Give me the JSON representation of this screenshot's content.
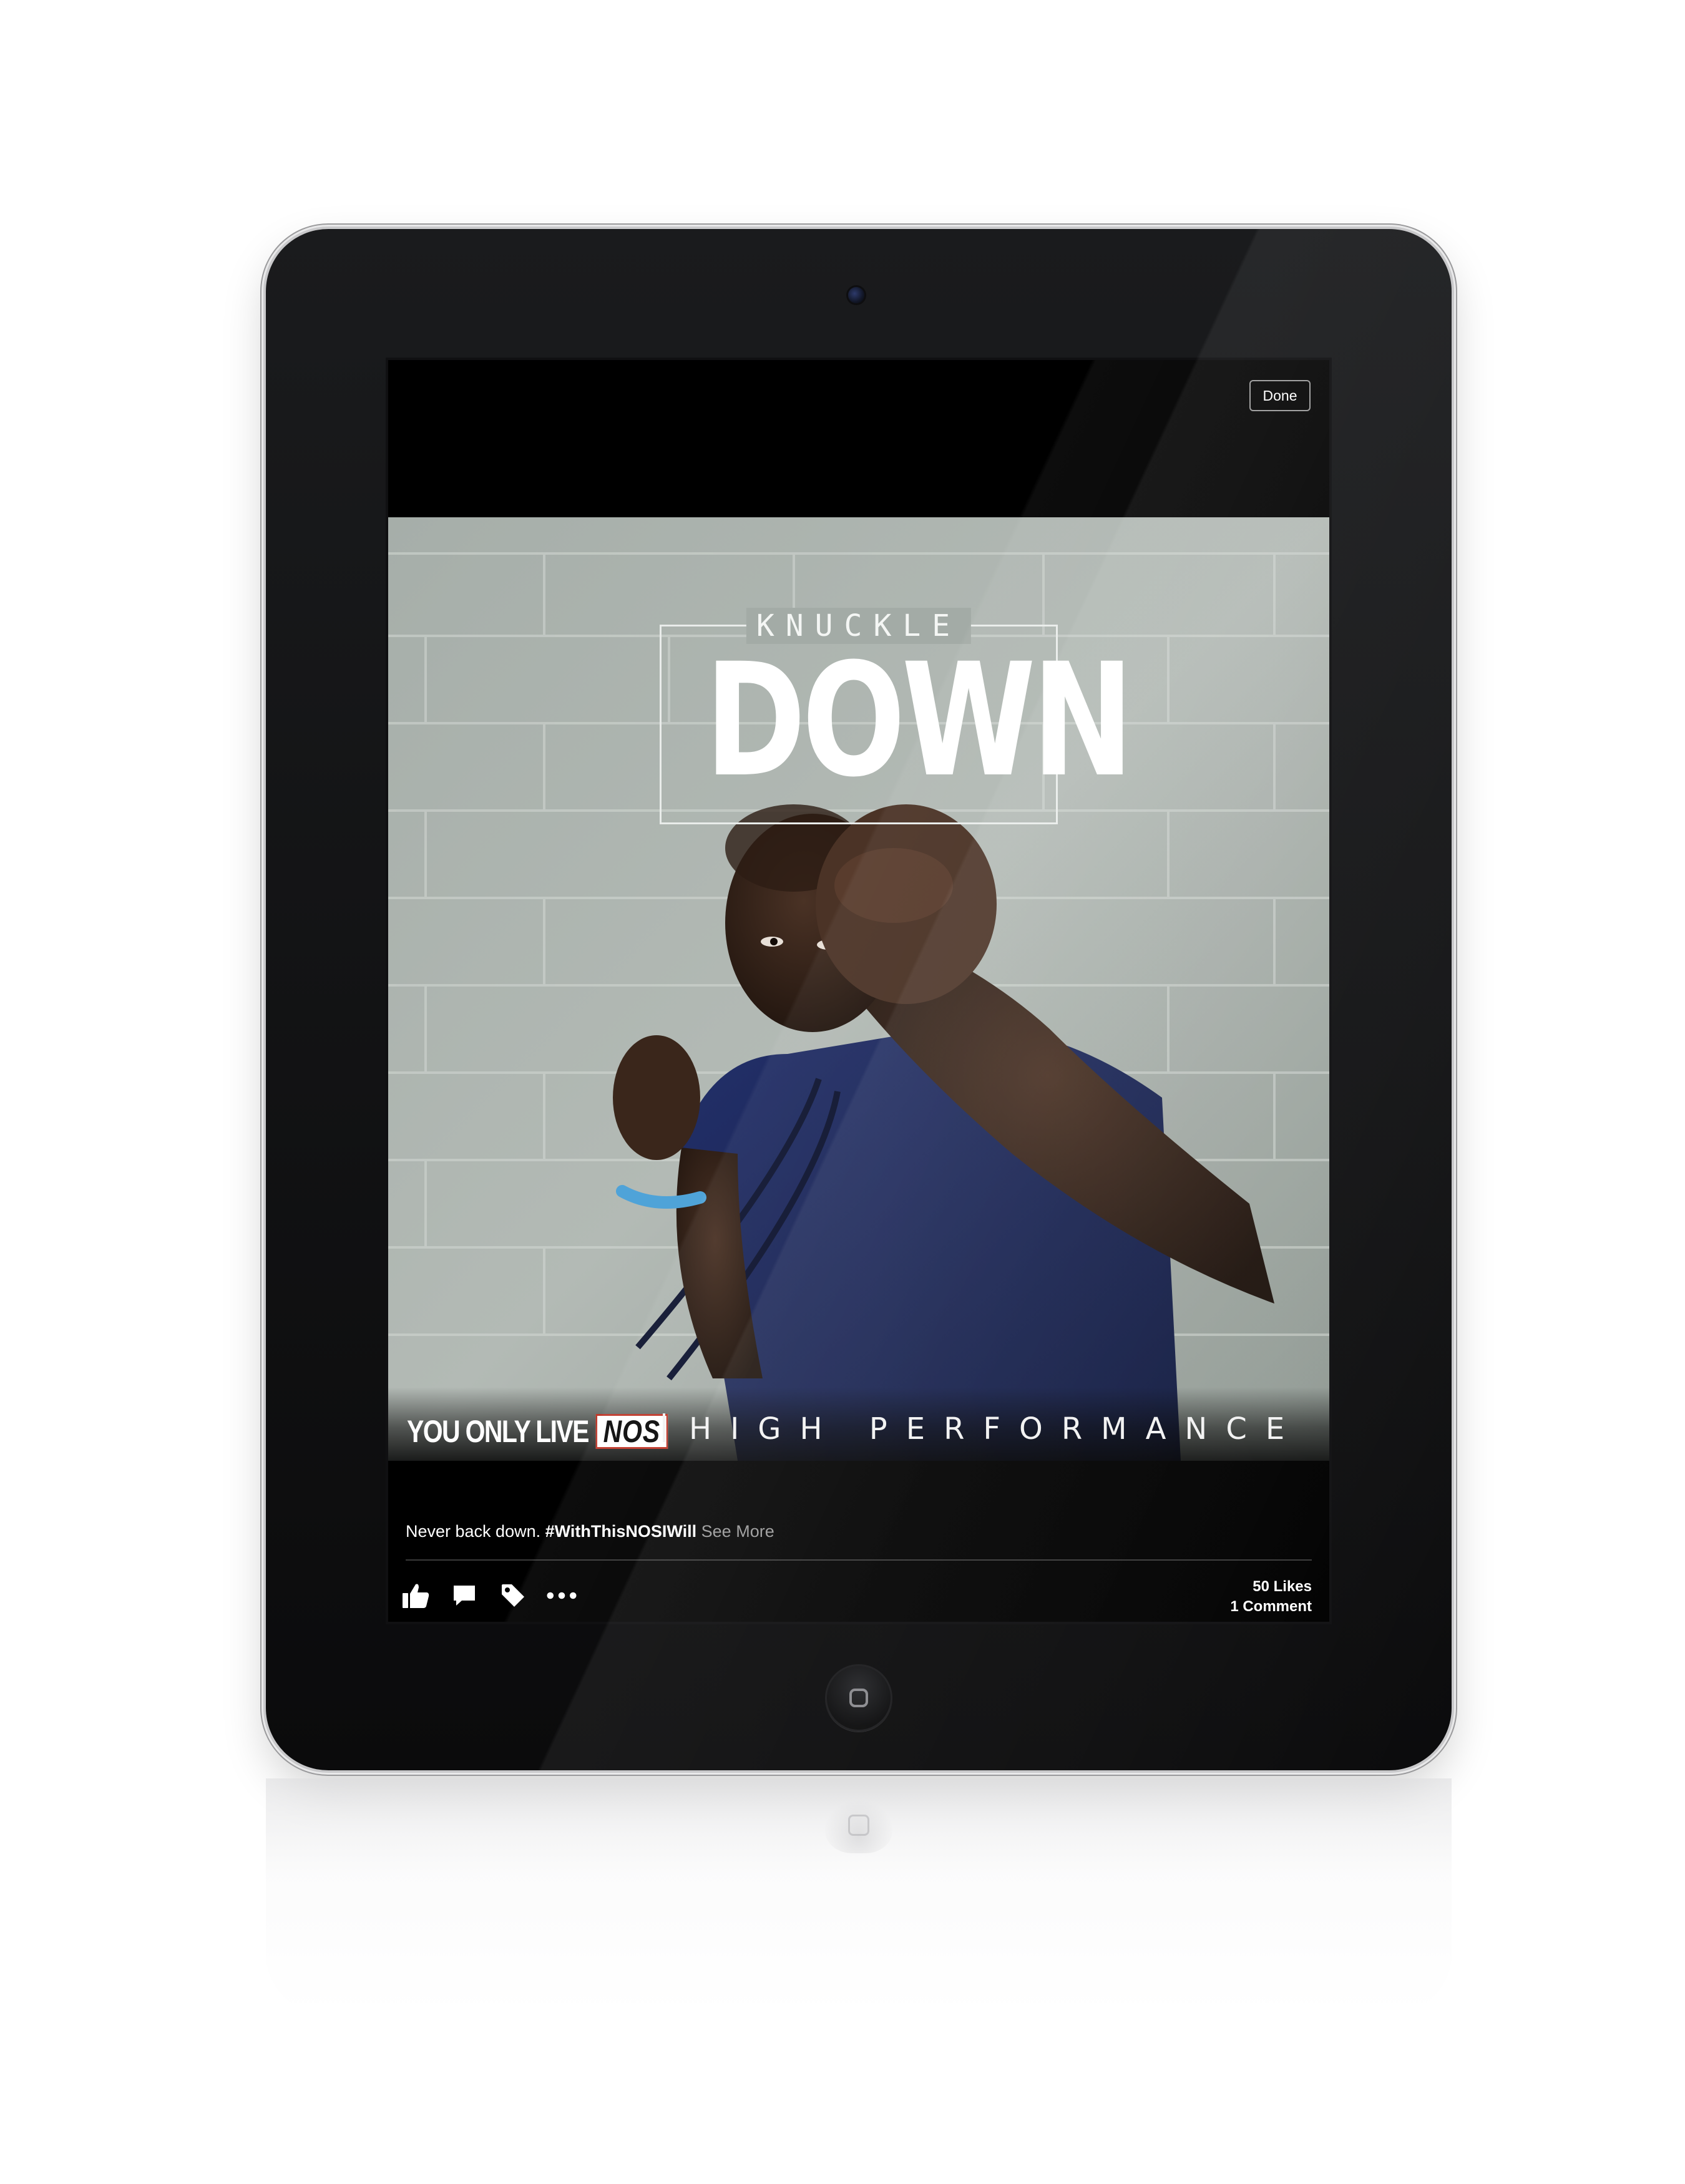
{
  "topbar": {
    "done_label": "Done"
  },
  "post": {
    "image": {
      "headline_small": "KNUCKLE",
      "headline_large": "DOWN",
      "tagline_brand": "YOU ONLY LIVE",
      "tagline_logo": "NOS",
      "tagline_sub": "HIGH PERFORMANCE ENERGY"
    },
    "caption": {
      "text": "Never back down.",
      "hashtag": "#WithThisNOSIWill",
      "see_more": "See More"
    },
    "actions": [
      {
        "name": "like-icon",
        "label": "Like"
      },
      {
        "name": "comment-icon",
        "label": "Comment"
      },
      {
        "name": "tag-icon",
        "label": "Tag"
      },
      {
        "name": "more-icon",
        "label": "More"
      }
    ],
    "likes": "50 Likes",
    "comments": "1 Comment"
  },
  "colors": {
    "screen_bg": "#000000",
    "text": "#ffffff",
    "muted": "#9a9a9a",
    "shirt": "#1e2a5a"
  }
}
